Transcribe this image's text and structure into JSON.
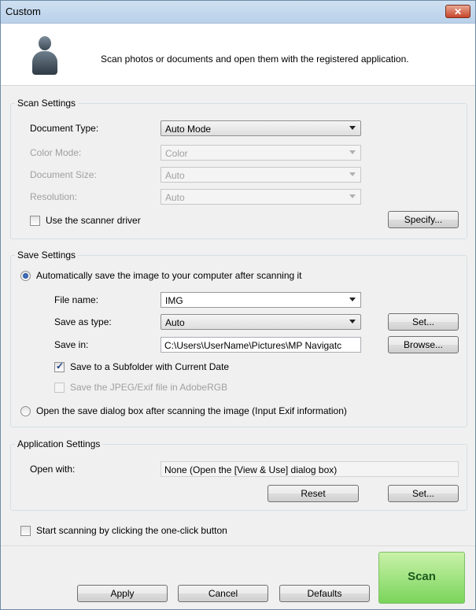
{
  "window": {
    "title": "Custom",
    "close_icon": "close-icon"
  },
  "header": {
    "description": "Scan photos or documents and open them with the registered application.",
    "icon": "person-icon"
  },
  "scan_settings": {
    "legend": "Scan Settings",
    "document_type_label": "Document Type:",
    "document_type_value": "Auto Mode",
    "color_mode_label": "Color Mode:",
    "color_mode_value": "Color",
    "document_size_label": "Document Size:",
    "document_size_value": "Auto",
    "resolution_label": "Resolution:",
    "resolution_value": "Auto",
    "use_driver_label": "Use the scanner driver",
    "use_driver_checked": false,
    "specify_button": "Specify..."
  },
  "save_settings": {
    "legend": "Save Settings",
    "auto_save_label": "Automatically save the image to your computer after scanning it",
    "file_name_label": "File name:",
    "file_name_value": "IMG",
    "save_as_type_label": "Save as type:",
    "save_as_type_value": "Auto",
    "set_button": "Set...",
    "save_in_label": "Save in:",
    "save_in_value": "C:\\Users\\UserName\\Pictures\\MP Navigatc",
    "browse_button": "Browse...",
    "subfolder_label": "Save to a Subfolder with Current Date",
    "subfolder_checked": true,
    "adobergb_label": "Save the JPEG/Exif file in AdobeRGB",
    "adobergb_checked": false,
    "open_dialog_label": "Open the save dialog box after scanning the image (Input Exif information)"
  },
  "application_settings": {
    "legend": "Application Settings",
    "open_with_label": "Open with:",
    "open_with_value": "None (Open the [View & Use] dialog box)",
    "reset_button": "Reset",
    "set_button": "Set..."
  },
  "one_click": {
    "label": "Start scanning by clicking the one-click button",
    "checked": false
  },
  "footer": {
    "apply": "Apply",
    "cancel": "Cancel",
    "defaults": "Defaults",
    "scan": "Scan"
  }
}
